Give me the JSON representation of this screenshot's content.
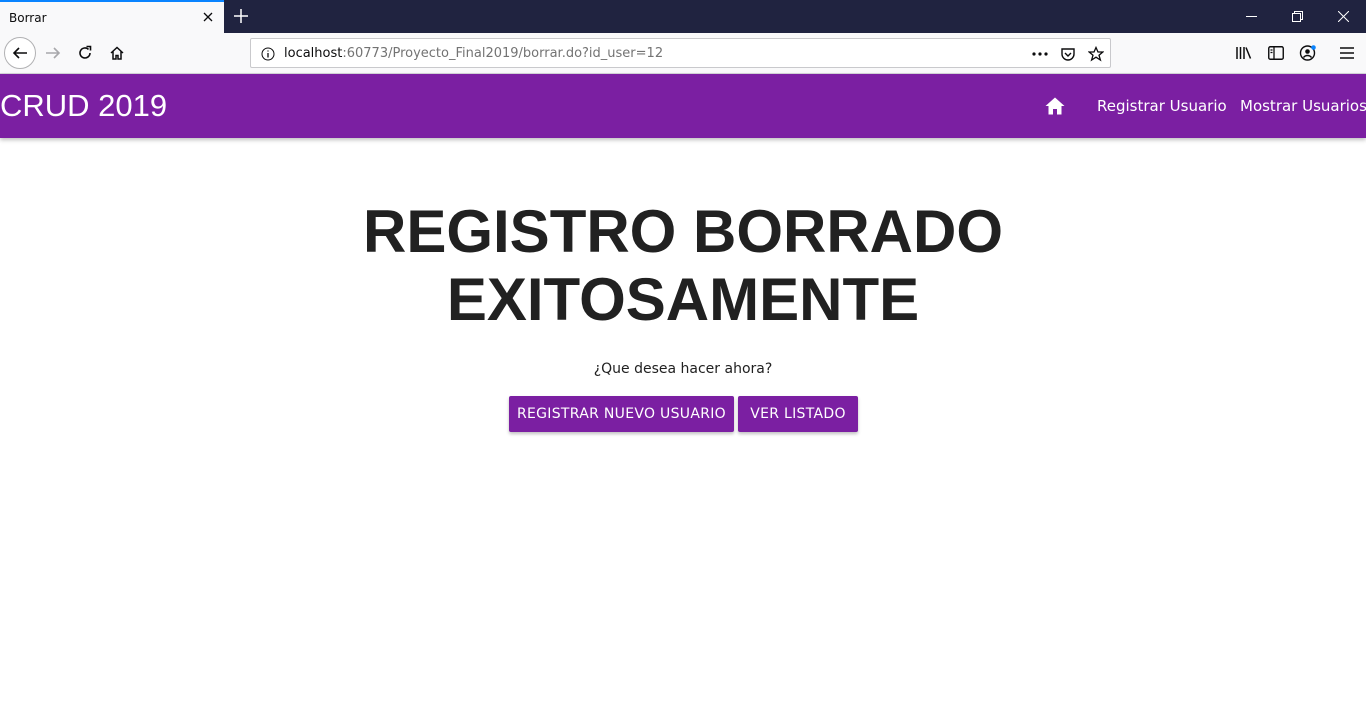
{
  "browser": {
    "tab_title": "Borrar",
    "url_host": "localhost",
    "url_rest": ":60773/Proyecto_Final2019/borrar.do?id_user=12"
  },
  "app": {
    "brand": "CRUD 2019",
    "nav": {
      "register_label": "Registrar Usuario",
      "show_label": "Mostrar Usuarios"
    },
    "accent_color": "#7b1fa2"
  },
  "main": {
    "heading_line1": "REGISTRO BORRADO",
    "heading_line2": "EXITOSAMENTE",
    "question": "¿Que desea hacer ahora?",
    "btn_register": "REGISTRAR NUEVO USUARIO",
    "btn_list": "VER LISTADO"
  }
}
